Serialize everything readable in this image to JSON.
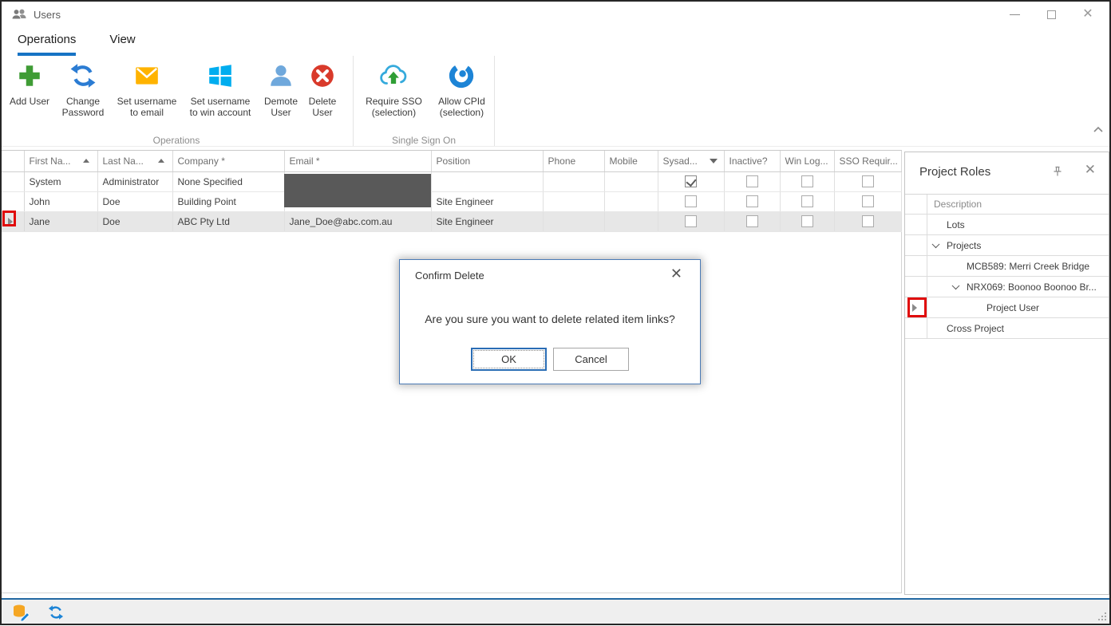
{
  "window": {
    "title": "Users",
    "controls": [
      {
        "name": "minimize"
      },
      {
        "name": "maximize"
      },
      {
        "name": "close"
      }
    ]
  },
  "tabs": [
    {
      "label": "Operations",
      "active": true
    },
    {
      "label": "View",
      "active": false
    }
  ],
  "ribbon": {
    "groups": [
      {
        "label": "Operations",
        "buttons": [
          {
            "icon": "add-user-icon",
            "line1": "Add User",
            "line2": ""
          },
          {
            "icon": "change-password-icon",
            "line1": "Change",
            "line2": "Password"
          },
          {
            "icon": "set-username-to-email-icon",
            "line1": "Set username",
            "line2": "to email"
          },
          {
            "icon": "set-username-to-win-account-icon",
            "line1": "Set username",
            "line2": "to win account"
          },
          {
            "icon": "demote-user-icon",
            "line1": "Demote",
            "line2": "User"
          },
          {
            "icon": "delete-user-icon",
            "line1": "Delete",
            "line2": "User"
          }
        ]
      },
      {
        "label": "Single Sign On",
        "buttons": [
          {
            "icon": "require-sso-icon",
            "line1": "Require SSO",
            "line2": "(selection)"
          },
          {
            "icon": "allow-cpid-icon",
            "line1": "Allow CPId",
            "line2": "(selection)"
          }
        ]
      }
    ]
  },
  "grid": {
    "columns": [
      {
        "label": "First Na...",
        "sort": "asc"
      },
      {
        "label": "Last Na...",
        "sort": "asc"
      },
      {
        "label": "Company *"
      },
      {
        "label": "Email *"
      },
      {
        "label": "Position"
      },
      {
        "label": "Phone"
      },
      {
        "label": "Mobile"
      },
      {
        "label": "Sysad...",
        "filter": true
      },
      {
        "label": "Inactive?"
      },
      {
        "label": "Win Log..."
      },
      {
        "label": "SSO Requir..."
      }
    ],
    "rows": [
      {
        "first": "System",
        "last": "Administrator",
        "company": "None Specified",
        "email": "",
        "email_redacted": true,
        "position": "",
        "phone": "",
        "mobile": "",
        "sysadmin": true,
        "inactive": false,
        "win_login": false,
        "sso_required": false,
        "selected": false
      },
      {
        "first": "John",
        "last": "Doe",
        "company": "Building Point",
        "email": "",
        "email_redacted": true,
        "position": "Site Engineer",
        "phone": "",
        "mobile": "",
        "sysadmin": false,
        "inactive": false,
        "win_login": false,
        "sso_required": false,
        "selected": false
      },
      {
        "first": "Jane",
        "last": "Doe",
        "company": "ABC Pty Ltd",
        "email": "Jane_Doe@abc.com.au",
        "email_redacted": false,
        "position": "Site Engineer",
        "phone": "",
        "mobile": "",
        "sysadmin": false,
        "inactive": false,
        "win_login": false,
        "sso_required": false,
        "selected": true
      }
    ]
  },
  "dialog": {
    "title": "Confirm Delete",
    "message": "Are you sure you want to delete related item links?",
    "ok_label": "OK",
    "cancel_label": "Cancel"
  },
  "panel": {
    "title": "Project Roles",
    "column_header": "Description",
    "rows": [
      {
        "label": "Lots",
        "level": 1,
        "expanded": false,
        "current": false
      },
      {
        "label": "Projects",
        "level": 1,
        "expanded": true,
        "current": false
      },
      {
        "label": "MCB589: Merri Creek Bridge",
        "level": 2,
        "expanded": false,
        "current": false
      },
      {
        "label": "NRX069: Boonoo Boonoo Br...",
        "level": 2,
        "expanded": true,
        "current": false
      },
      {
        "label": "Project User",
        "level": 3,
        "expanded": false,
        "current": true
      },
      {
        "label": "Cross Project",
        "level": 1,
        "expanded": false,
        "current": false
      }
    ]
  },
  "statusbar": {
    "icons": [
      "edit-database-icon",
      "refresh-icon"
    ]
  },
  "annotations": {
    "color": "#e00b0b",
    "items": [
      "grid-current-row-marker-highlight",
      "panel-current-row-marker-highlight"
    ]
  },
  "colors": {
    "accent": "#1673c4",
    "selected_row": "#e7e7e7",
    "status_border": "#2368a2",
    "dialog_border": "#4a7ab5",
    "redaction": "#595959"
  }
}
